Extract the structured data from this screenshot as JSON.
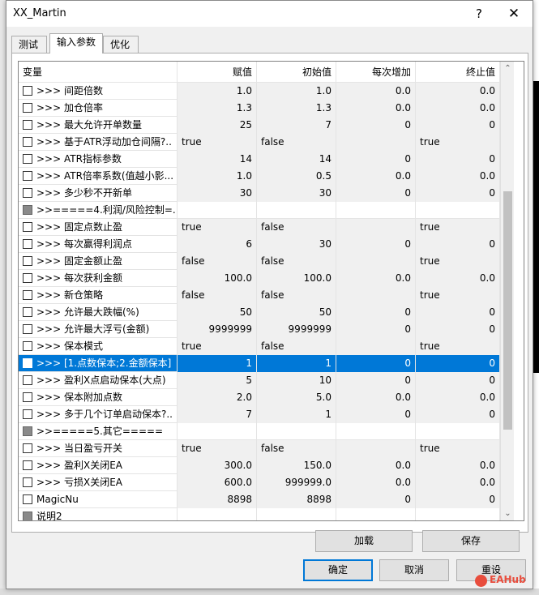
{
  "window": {
    "title": "XX_Martin",
    "help_glyph": "?",
    "close_glyph": "✕"
  },
  "tabs": [
    {
      "label": "测试"
    },
    {
      "label": "输入参数"
    },
    {
      "label": "优化"
    }
  ],
  "columns": [
    "变量",
    "赋值",
    "初始值",
    "每次增加",
    "终止值"
  ],
  "rows": [
    {
      "name": ">>>  间距倍数",
      "value": "1.0",
      "start": "1.0",
      "step": "0.0",
      "stop": "0.0",
      "type": "num",
      "checkbox": "empty"
    },
    {
      "name": ">>>  加仓倍率",
      "value": "1.3",
      "start": "1.3",
      "step": "0.0",
      "stop": "0.0",
      "type": "num",
      "checkbox": "empty"
    },
    {
      "name": ">>>  最大允许开单数量",
      "value": "25",
      "start": "7",
      "step": "0",
      "stop": "0",
      "type": "num",
      "checkbox": "empty"
    },
    {
      "name": ">>>  基于ATR浮动加仓间隔?..",
      "value": "true",
      "start": "false",
      "step": "",
      "stop": "true",
      "type": "bool",
      "checkbox": "empty"
    },
    {
      "name": ">>>  ATR指标参数",
      "value": "14",
      "start": "14",
      "step": "0",
      "stop": "0",
      "type": "num",
      "checkbox": "empty"
    },
    {
      "name": ">>>  ATR倍率系数(值越小影...",
      "value": "1.0",
      "start": "0.5",
      "step": "0.0",
      "stop": "0.0",
      "type": "num",
      "checkbox": "empty"
    },
    {
      "name": ">>>  多少秒不开新单",
      "value": "30",
      "start": "30",
      "step": "0",
      "stop": "0",
      "type": "num",
      "checkbox": "empty"
    },
    {
      "name": ">>=====4.利润/风险控制=...",
      "value": "",
      "start": "",
      "step": "",
      "stop": "",
      "type": "section",
      "checkbox": "indeterminate"
    },
    {
      "name": ">>>  固定点数止盈",
      "value": "true",
      "start": "false",
      "step": "",
      "stop": "true",
      "type": "bool",
      "checkbox": "empty"
    },
    {
      "name": ">>>  每次赢得利润点",
      "value": "6",
      "start": "30",
      "step": "0",
      "stop": "0",
      "type": "num",
      "checkbox": "empty"
    },
    {
      "name": ">>>  固定金额止盈",
      "value": "false",
      "start": "false",
      "step": "",
      "stop": "true",
      "type": "bool",
      "checkbox": "empty"
    },
    {
      "name": ">>>  每次获利金额",
      "value": "100.0",
      "start": "100.0",
      "step": "0.0",
      "stop": "0.0",
      "type": "num",
      "checkbox": "empty"
    },
    {
      "name": ">>>  新仓策略",
      "value": "false",
      "start": "false",
      "step": "",
      "stop": "true",
      "type": "bool",
      "checkbox": "empty"
    },
    {
      "name": ">>>  允许最大跌幅(%)",
      "value": "50",
      "start": "50",
      "step": "0",
      "stop": "0",
      "type": "num",
      "checkbox": "empty"
    },
    {
      "name": ">>>  允许最大浮亏(金额)",
      "value": "9999999",
      "start": "9999999",
      "step": "0",
      "stop": "0",
      "type": "num",
      "checkbox": "empty"
    },
    {
      "name": ">>>  保本模式",
      "value": "true",
      "start": "false",
      "step": "",
      "stop": "true",
      "type": "bool",
      "checkbox": "empty"
    },
    {
      "name": ">>>  [1.点数保本;2.金额保本]",
      "value": "1",
      "start": "1",
      "step": "0",
      "stop": "0",
      "type": "num",
      "checkbox": "empty",
      "selected": true
    },
    {
      "name": ">>>  盈利X点启动保本(大点)",
      "value": "5",
      "start": "10",
      "step": "0",
      "stop": "0",
      "type": "num",
      "checkbox": "empty"
    },
    {
      "name": ">>>  保本附加点数",
      "value": "2.0",
      "start": "5.0",
      "step": "0.0",
      "stop": "0.0",
      "type": "num",
      "checkbox": "empty"
    },
    {
      "name": ">>>  多于几个订单启动保本?..",
      "value": "7",
      "start": "1",
      "step": "0",
      "stop": "0",
      "type": "num",
      "checkbox": "empty"
    },
    {
      "name": ">>=====5.其它=====",
      "value": "",
      "start": "",
      "step": "",
      "stop": "",
      "type": "section",
      "checkbox": "indeterminate"
    },
    {
      "name": ">>>  当日盈亏开关",
      "value": "true",
      "start": "false",
      "step": "",
      "stop": "true",
      "type": "bool",
      "checkbox": "empty"
    },
    {
      "name": ">>>  盈利X关闭EA",
      "value": "300.0",
      "start": "150.0",
      "step": "0.0",
      "stop": "0.0",
      "type": "num",
      "checkbox": "empty"
    },
    {
      "name": ">>>  亏损X关闭EA",
      "value": "600.0",
      "start": "999999.0",
      "step": "0.0",
      "stop": "0.0",
      "type": "num",
      "checkbox": "empty"
    },
    {
      "name": "MagicNu",
      "value": "8898",
      "start": "8898",
      "step": "0",
      "stop": "0",
      "type": "num",
      "checkbox": "empty"
    },
    {
      "name": "说明2",
      "value": "",
      "start": "",
      "step": "",
      "stop": "",
      "type": "section",
      "checkbox": "indeterminate"
    }
  ],
  "buttons": {
    "load": "加载",
    "save": "保存",
    "ok": "确定",
    "cancel": "取消",
    "reset": "重设"
  },
  "scrollbar": {
    "up_glyph": "⌃",
    "down_glyph": "⌄"
  },
  "watermark": "EAHub",
  "colors": {
    "selection": "#0078d7",
    "default_button_border": "#0078d7",
    "brand": "#e84d3d"
  }
}
